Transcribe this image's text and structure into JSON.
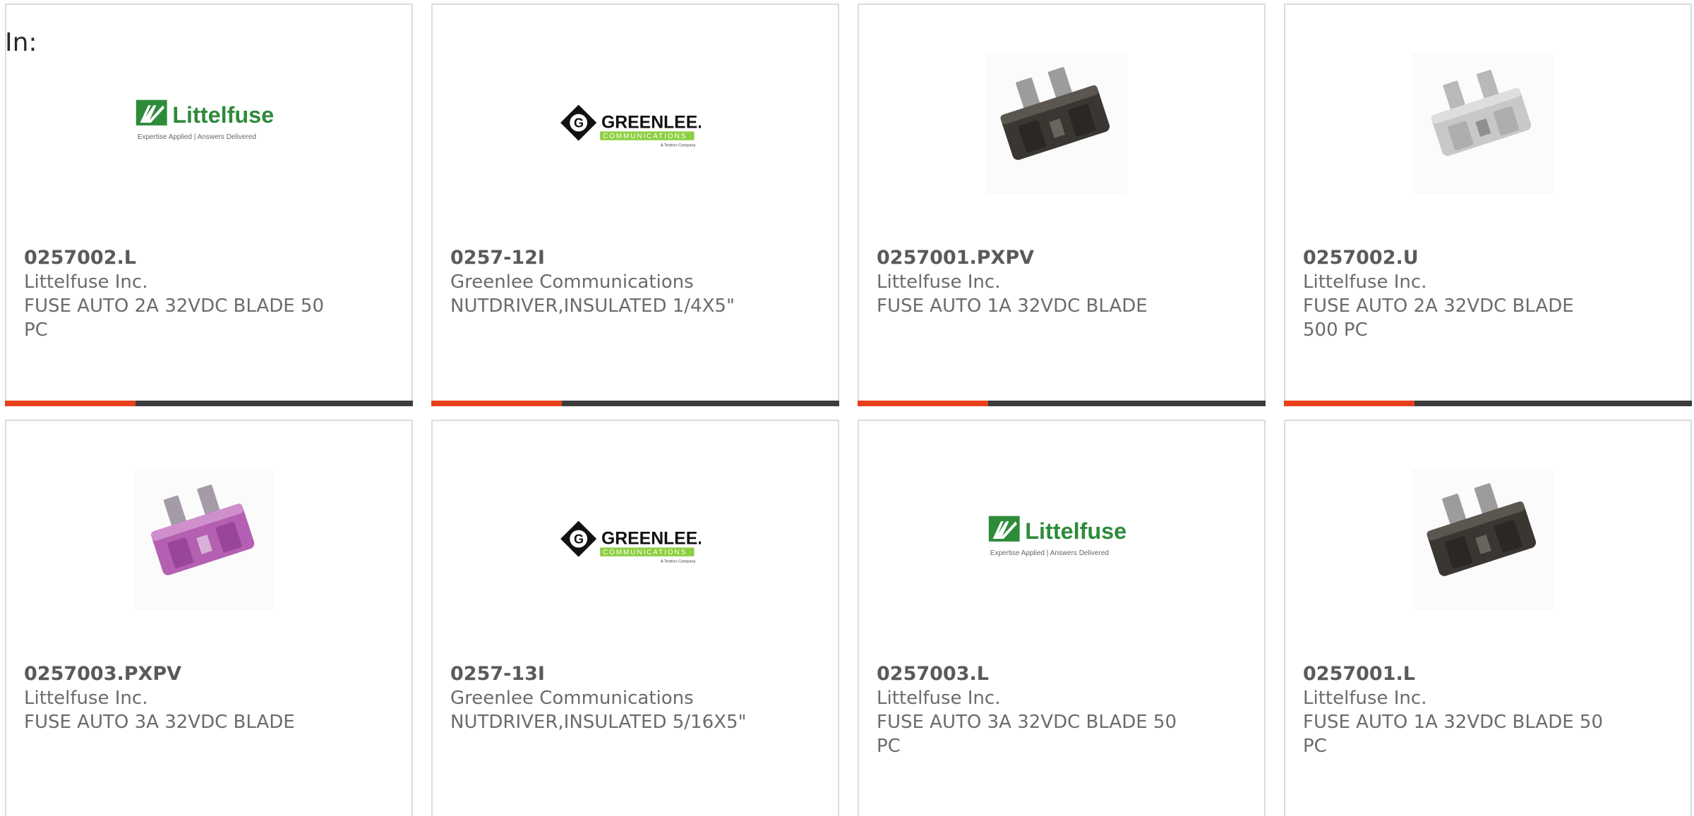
{
  "header": {
    "label": "In:"
  },
  "colors": {
    "accent": "#e8401c",
    "track": "#3d3d3d"
  },
  "cards": [
    {
      "part_number": "0257002.L",
      "manufacturer": "Littelfuse Inc.",
      "description": "FUSE AUTO 2A 32VDC BLADE 50 PC",
      "image": "littelfuse-logo",
      "logo_text": {
        "brand": "Littelfuse",
        "tagline": "Expertise Applied | Answers Delivered"
      },
      "progress": 0.32
    },
    {
      "part_number": "0257-12I",
      "manufacturer": "Greenlee Communications",
      "description": "NUTDRIVER,INSULATED 1/4X5\"",
      "image": "greenlee-logo",
      "logo_text": {
        "brand": "GREENLEE.",
        "sub": "COMMUNICATIONS",
        "tagline": "A Textron Company"
      },
      "progress": 0.32
    },
    {
      "part_number": "0257001.PXPV",
      "manufacturer": "Littelfuse Inc.",
      "description": "FUSE AUTO 1A 32VDC BLADE",
      "image": "fuse-black",
      "progress": 0.32
    },
    {
      "part_number": "0257002.U",
      "manufacturer": "Littelfuse Inc.",
      "description": "FUSE AUTO 2A 32VDC BLADE 500 PC",
      "image": "fuse-clear",
      "progress": 0.32
    },
    {
      "part_number": "0257003.PXPV",
      "manufacturer": "Littelfuse Inc.",
      "description": "FUSE AUTO 3A 32VDC BLADE",
      "image": "fuse-violet"
    },
    {
      "part_number": "0257-13I",
      "manufacturer": "Greenlee Communications",
      "description": "NUTDRIVER,INSULATED 5/16X5\"",
      "image": "greenlee-logo",
      "logo_text": {
        "brand": "GREENLEE.",
        "sub": "COMMUNICATIONS",
        "tagline": "A Textron Company"
      }
    },
    {
      "part_number": "0257003.L",
      "manufacturer": "Littelfuse Inc.",
      "description": "FUSE AUTO 3A 32VDC BLADE 50 PC",
      "image": "littelfuse-logo",
      "logo_text": {
        "brand": "Littelfuse",
        "tagline": "Expertise Applied | Answers Delivered"
      }
    },
    {
      "part_number": "0257001.L",
      "manufacturer": "Littelfuse Inc.",
      "description": "FUSE AUTO 1A 32VDC BLADE 50 PC",
      "image": "fuse-black"
    }
  ]
}
